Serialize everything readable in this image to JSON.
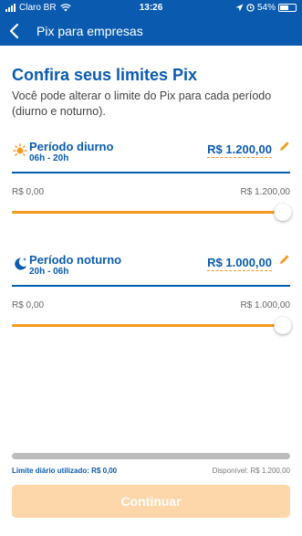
{
  "status_bar": {
    "carrier": "Claro BR",
    "time": "13:26",
    "battery": "54%",
    "battery_level": 0.54
  },
  "header": {
    "title": "Pix para empresas"
  },
  "intro": {
    "title": "Confira seus limites Pix",
    "description": "Você pode alterar o limite do Pix para cada período (diurno e noturno)."
  },
  "periods": [
    {
      "name": "Período diurno",
      "hours": "06h - 20h",
      "value": "R$ 1.200,00",
      "min": "R$ 0,00",
      "max": "R$ 1.200,00",
      "slider_fraction": 1.0,
      "icon": "sun-icon"
    },
    {
      "name": "Período noturno",
      "hours": "20h - 06h",
      "value": "R$ 1.000,00",
      "min": "R$ 0,00",
      "max": "R$ 1.000,00",
      "slider_fraction": 1.0,
      "icon": "moon-icon"
    }
  ],
  "usage": {
    "used_label": "Limite diário utilizado: R$ 0,00",
    "available_label": "Disponível: R$ 1.200,00",
    "used_fraction": 0.0
  },
  "actions": {
    "continue_label": "Continuar"
  },
  "colors": {
    "brand_blue": "#0a5bb0",
    "accent_orange": "#f29a1f",
    "button_disabled": "#fdd6a9"
  }
}
